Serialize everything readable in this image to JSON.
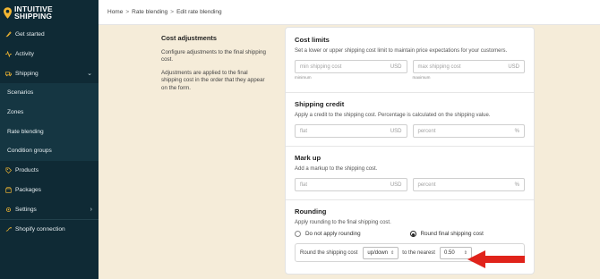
{
  "brand": {
    "line1": "INTUITIVE",
    "line2": "SHIPPING"
  },
  "breadcrumb": [
    "Home",
    "Rate blending",
    "Edit rate blending"
  ],
  "breadcrumb_sep": ">",
  "sidebar": {
    "items": [
      {
        "label": "Get started"
      },
      {
        "label": "Activity"
      },
      {
        "label": "Shipping"
      },
      {
        "label": "Scenarios"
      },
      {
        "label": "Zones"
      },
      {
        "label": "Rate blending"
      },
      {
        "label": "Condition groups"
      },
      {
        "label": "Products"
      },
      {
        "label": "Packages"
      },
      {
        "label": "Settings"
      },
      {
        "label": "Shopify connection"
      }
    ]
  },
  "description": {
    "title": "Cost adjustments",
    "p1": "Configure adjustments to the final shipping cost.",
    "p2": "Adjustments are applied to the final shipping cost in the order that they appear on the form."
  },
  "cost_limits": {
    "title": "Cost limits",
    "help": "Set a lower or upper shipping cost limit to maintain price expectations for your customers.",
    "min_placeholder": "min shipping cost",
    "max_placeholder": "max shipping cost",
    "currency": "USD",
    "min_label": "minimum",
    "max_label": "maximum"
  },
  "shipping_credit": {
    "title": "Shipping credit",
    "help": "Apply a credit to the shipping cost. Percentage is calculated on the shipping value.",
    "flat_placeholder": "flat",
    "percent_placeholder": "percent",
    "currency": "USD",
    "percent_unit": "%"
  },
  "mark_up": {
    "title": "Mark up",
    "help": "Add a markup to the shipping cost.",
    "flat_placeholder": "flat",
    "percent_placeholder": "percent",
    "currency": "USD",
    "percent_unit": "%"
  },
  "rounding": {
    "title": "Rounding",
    "help": "Apply rounding to the final shipping cost.",
    "option_none": "Do not apply rounding",
    "option_round": "Round final shipping cost",
    "selected": "round",
    "round_label": "Round the shipping cost",
    "direction": "up/down",
    "nearest_label": "to the nearest",
    "nearest_value": "0.50"
  },
  "colors": {
    "sidebar": "#0f2a35",
    "accent": "#f2b632",
    "arrow": "#e0231b",
    "background": "#f5ecd9"
  }
}
